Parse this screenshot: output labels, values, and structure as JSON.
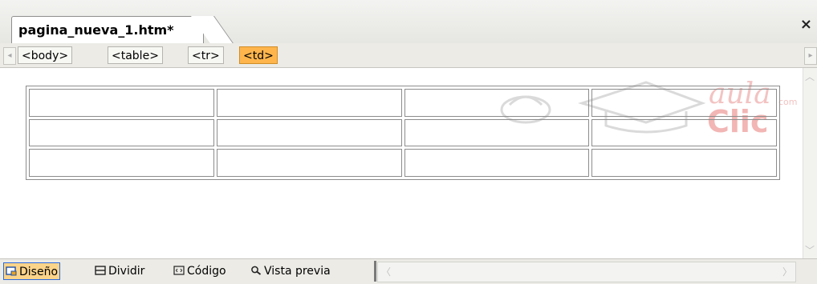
{
  "document": {
    "tab_title": "pagina_nueva_1.htm*",
    "close_symbol": "×"
  },
  "tag_selector": {
    "tags": [
      "<body>",
      "<table>",
      "<tr>",
      "<td>"
    ],
    "active_tag": "<td>"
  },
  "design_view": {
    "table": {
      "rows": 3,
      "columns": 4
    },
    "watermark": {
      "text": "aula Clic",
      "suffix": "com"
    }
  },
  "view_modes": {
    "items": [
      {
        "label": "Diseño",
        "icon": "design-view-icon",
        "selected": true
      },
      {
        "label": "Dividir",
        "icon": "split-view-icon",
        "selected": false
      },
      {
        "label": "Código",
        "icon": "code-view-icon",
        "selected": false
      },
      {
        "label": "Vista previa",
        "icon": "magnifier-icon",
        "selected": false
      }
    ]
  },
  "colors": {
    "active_tag": "#ffb54c",
    "selected_view": "#fbd48a",
    "watermark": "#f2b6b4"
  }
}
